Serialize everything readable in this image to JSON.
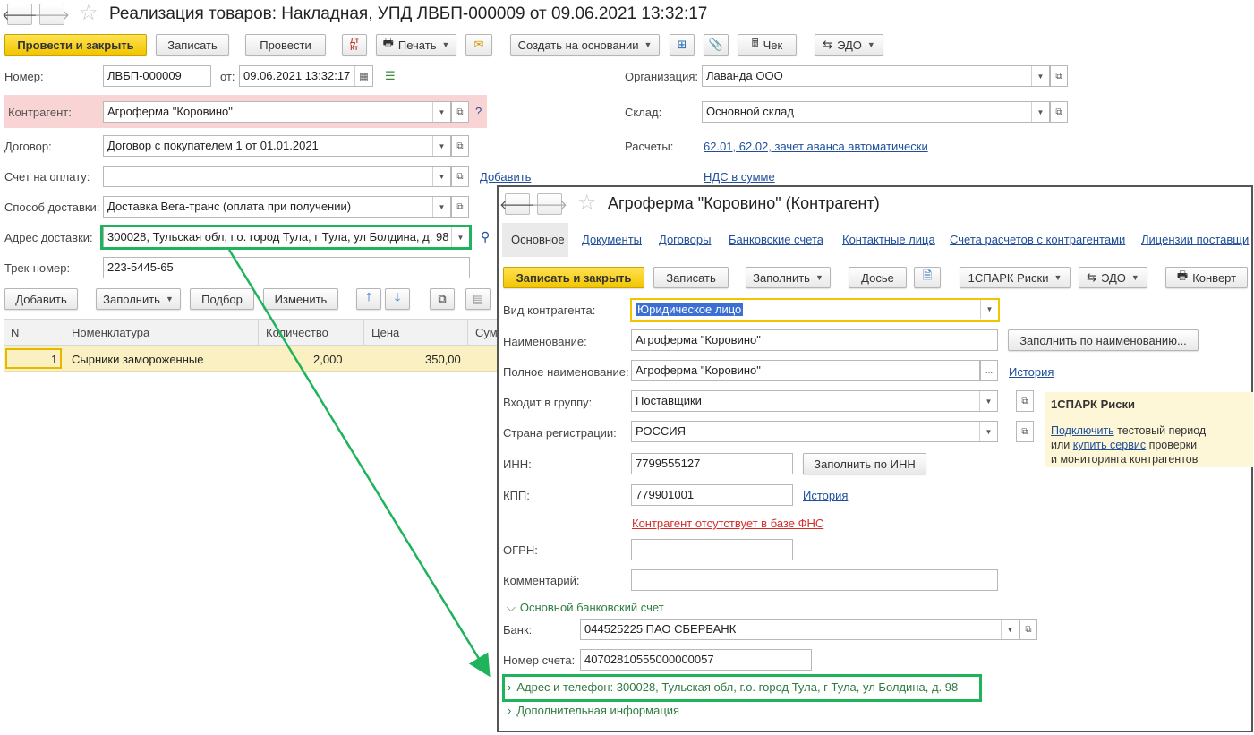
{
  "document": {
    "title": "Реализация товаров: Накладная, УПД ЛВБП-000009 от 09.06.2021 13:32:17",
    "toolbar": {
      "post_close": "Провести и закрыть",
      "save": "Записать",
      "post": "Провести",
      "print": "Печать",
      "create_based": "Создать на основании",
      "receipt": "Чек",
      "edo": "ЭДО"
    },
    "number_label": "Номер:",
    "number_value": "ЛВБП-000009",
    "from_label": "от:",
    "date_value": "09.06.2021 13:32:17",
    "org_label": "Организация:",
    "org_value": "Лаванда ООО",
    "counterparty_label": "Контрагент:",
    "counterparty_value": "Агроферма \"Коровино\"",
    "question": "?",
    "warehouse_label": "Склад:",
    "warehouse_value": "Основной склад",
    "contract_label": "Договор:",
    "contract_value": "Договор с покупателем 1 от 01.01.2021",
    "settlements_label": "Расчеты:",
    "settlements_link": "62.01, 62.02, зачет аванса автоматически",
    "invoice_label": "Счет на оплату:",
    "invoice_value": "",
    "add_link": "Добавить",
    "vat_link": "НДС в сумме",
    "delivery_label": "Способ доставки:",
    "delivery_value": "Доставка Вега-транс (оплата при получении)",
    "address_label": "Адрес доставки:",
    "address_value": "300028, Тульская обл, г.о. город Тула, г Тула, ул Болдина, д. 98",
    "track_label": "Трек-номер:",
    "track_value": "223-5445-65",
    "table_toolbar": {
      "add": "Добавить",
      "fill": "Заполнить",
      "pick": "Подбор",
      "change": "Изменить"
    },
    "table": {
      "headers": [
        "N",
        "Номенклатура",
        "Количество",
        "Цена",
        "Сум"
      ],
      "rows": [
        {
          "n": "1",
          "item": "Сырники замороженные",
          "qty": "2,000",
          "price": "350,00"
        }
      ]
    }
  },
  "counterparty_form": {
    "title": "Агроферма \"Коровино\" (Контрагент)",
    "tabs": [
      "Основное",
      "Документы",
      "Договоры",
      "Банковские счета",
      "Контактные лица",
      "Счета расчетов с контрагентами",
      "Лицензии поставщи"
    ],
    "toolbar": {
      "save_close": "Записать и закрыть",
      "save": "Записать",
      "fill": "Заполнить",
      "dossier": "Досье",
      "spark": "1СПАРК Риски",
      "edo": "ЭДО",
      "envelope": "Конверт"
    },
    "kind_label": "Вид контрагента:",
    "kind_value": "Юридическое лицо",
    "name_label": "Наименование:",
    "name_value": "Агроферма \"Коровино\"",
    "fill_by_name": "Заполнить по наименованию...",
    "full_name_label": "Полное наименование:",
    "full_name_value": "Агроферма \"Коровино\"",
    "history": "История",
    "ellipsis": "...",
    "group_label": "Входит в группу:",
    "group_value": "Поставщики",
    "country_label": "Страна регистрации:",
    "country_value": "РОССИЯ",
    "inn_label": "ИНН:",
    "inn_value": "7799555127",
    "fill_by_inn": "Заполнить по ИНН",
    "kpp_label": "КПП:",
    "kpp_value": "779901001",
    "fns_warning": "Контрагент отсутствует в базе ФНС",
    "ogrn_label": "ОГРН:",
    "ogrn_value": "",
    "comment_label": "Комментарий:",
    "comment_value": "",
    "bank_section": "Основной банковский счет",
    "bank_label": "Банк:",
    "bank_value": "044525225 ПАО СБЕРБАНК",
    "account_label": "Номер счета:",
    "account_value": "40702810555000000057",
    "address_section": "Адрес и телефон: 300028, Тульская обл, г.о. город Тула, г Тула, ул Болдина, д. 98",
    "extra_section": "Дополнительная информация",
    "spark_panel": {
      "title": "1СПАРК Риски",
      "connect": "Подключить",
      "text1": " тестовый период",
      "or": "или ",
      "buy": "купить сервис",
      "text2": " проверки",
      "text3": "и мониторинга контрагентов"
    }
  },
  "colors": {
    "highlight_green": "#1fb35b",
    "primary_yellow": "#f2c500",
    "counterparty_bg": "#f9d4d4",
    "link_blue": "#1f4e9a",
    "error_red": "#d62b2b"
  }
}
